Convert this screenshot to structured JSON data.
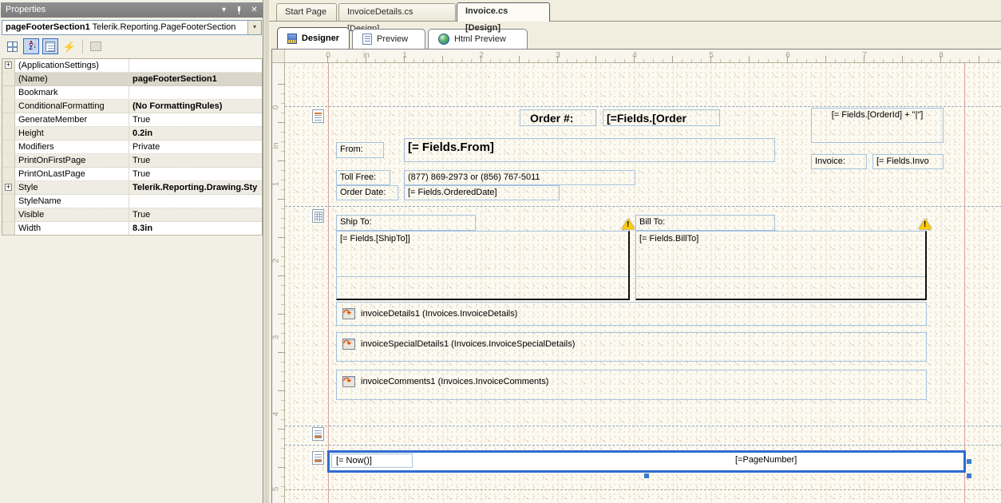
{
  "icons": {
    "close": "✕",
    "dropdown_arrow": "▾",
    "expand_plus": "+"
  },
  "properties_panel": {
    "title": "Properties",
    "object_name": "pageFooterSection1",
    "object_type": "Telerik.Reporting.PageFooterSection",
    "rows": [
      {
        "name": "(ApplicationSettings)",
        "value": ""
      },
      {
        "name": "(Name)",
        "value": "pageFooterSection1"
      },
      {
        "name": "Bookmark",
        "value": ""
      },
      {
        "name": "ConditionalFormatting",
        "value": "(No FormattingRules)"
      },
      {
        "name": "GenerateMember",
        "value": "True"
      },
      {
        "name": "Height",
        "value": "0.2in"
      },
      {
        "name": "Modifiers",
        "value": "Private"
      },
      {
        "name": "PrintOnFirstPage",
        "value": "True"
      },
      {
        "name": "PrintOnLastPage",
        "value": "True"
      },
      {
        "name": "Style",
        "value": "Telerik.Reporting.Drawing.Sty"
      },
      {
        "name": "StyleName",
        "value": ""
      },
      {
        "name": "Visible",
        "value": "True"
      },
      {
        "name": "Width",
        "value": "8.3in"
      }
    ]
  },
  "document_tabs": [
    {
      "label": "Start Page"
    },
    {
      "label": "InvoiceDetails.cs [Design]"
    },
    {
      "label": "Invoice.cs [Design]"
    }
  ],
  "designer_tabs": [
    {
      "label": "Designer"
    },
    {
      "label": "Preview"
    },
    {
      "label": "Html Preview"
    }
  ],
  "ruler": {
    "h_labels": [
      "0",
      "in",
      "1",
      "2",
      "3",
      "4",
      "5",
      "6",
      "7",
      "8"
    ],
    "v_labels": [
      "0",
      "in",
      "1",
      "2",
      "3",
      "4",
      "5"
    ]
  },
  "report": {
    "page_header": {
      "order_label": "Order #:",
      "order_value": "[=Fields.[Order",
      "orderid_expr": "[= Fields.[OrderId] + \"|\"]",
      "invoice_label": "Invoice:",
      "invoice_value": "[= Fields.Invo",
      "from_label": "From:",
      "from_value": "[= Fields.From]",
      "tollfree_label": "Toll Free:",
      "tollfree_value": "(877) 869-2973 or (856) 767-5011",
      "orderdate_label": "Order Date:",
      "orderdate_value": "[= Fields.OrderedDate]"
    },
    "detail": {
      "shipto_label": "Ship To:",
      "shipto_value": "[= Fields.[ShipTo]]",
      "billto_label": "Bill To:",
      "billto_value": "[= Fields.BillTo]",
      "subreports": [
        "invoiceDetails1 (Invoices.InvoiceDetails)",
        "invoiceSpecialDetails1 (Invoices.InvoiceSpecialDetails)",
        "invoiceComments1 (Invoices.InvoiceComments)"
      ]
    },
    "page_footer": {
      "now_expr": "[= Now()]",
      "pagenumber_expr": "[=PageNumber]"
    }
  }
}
